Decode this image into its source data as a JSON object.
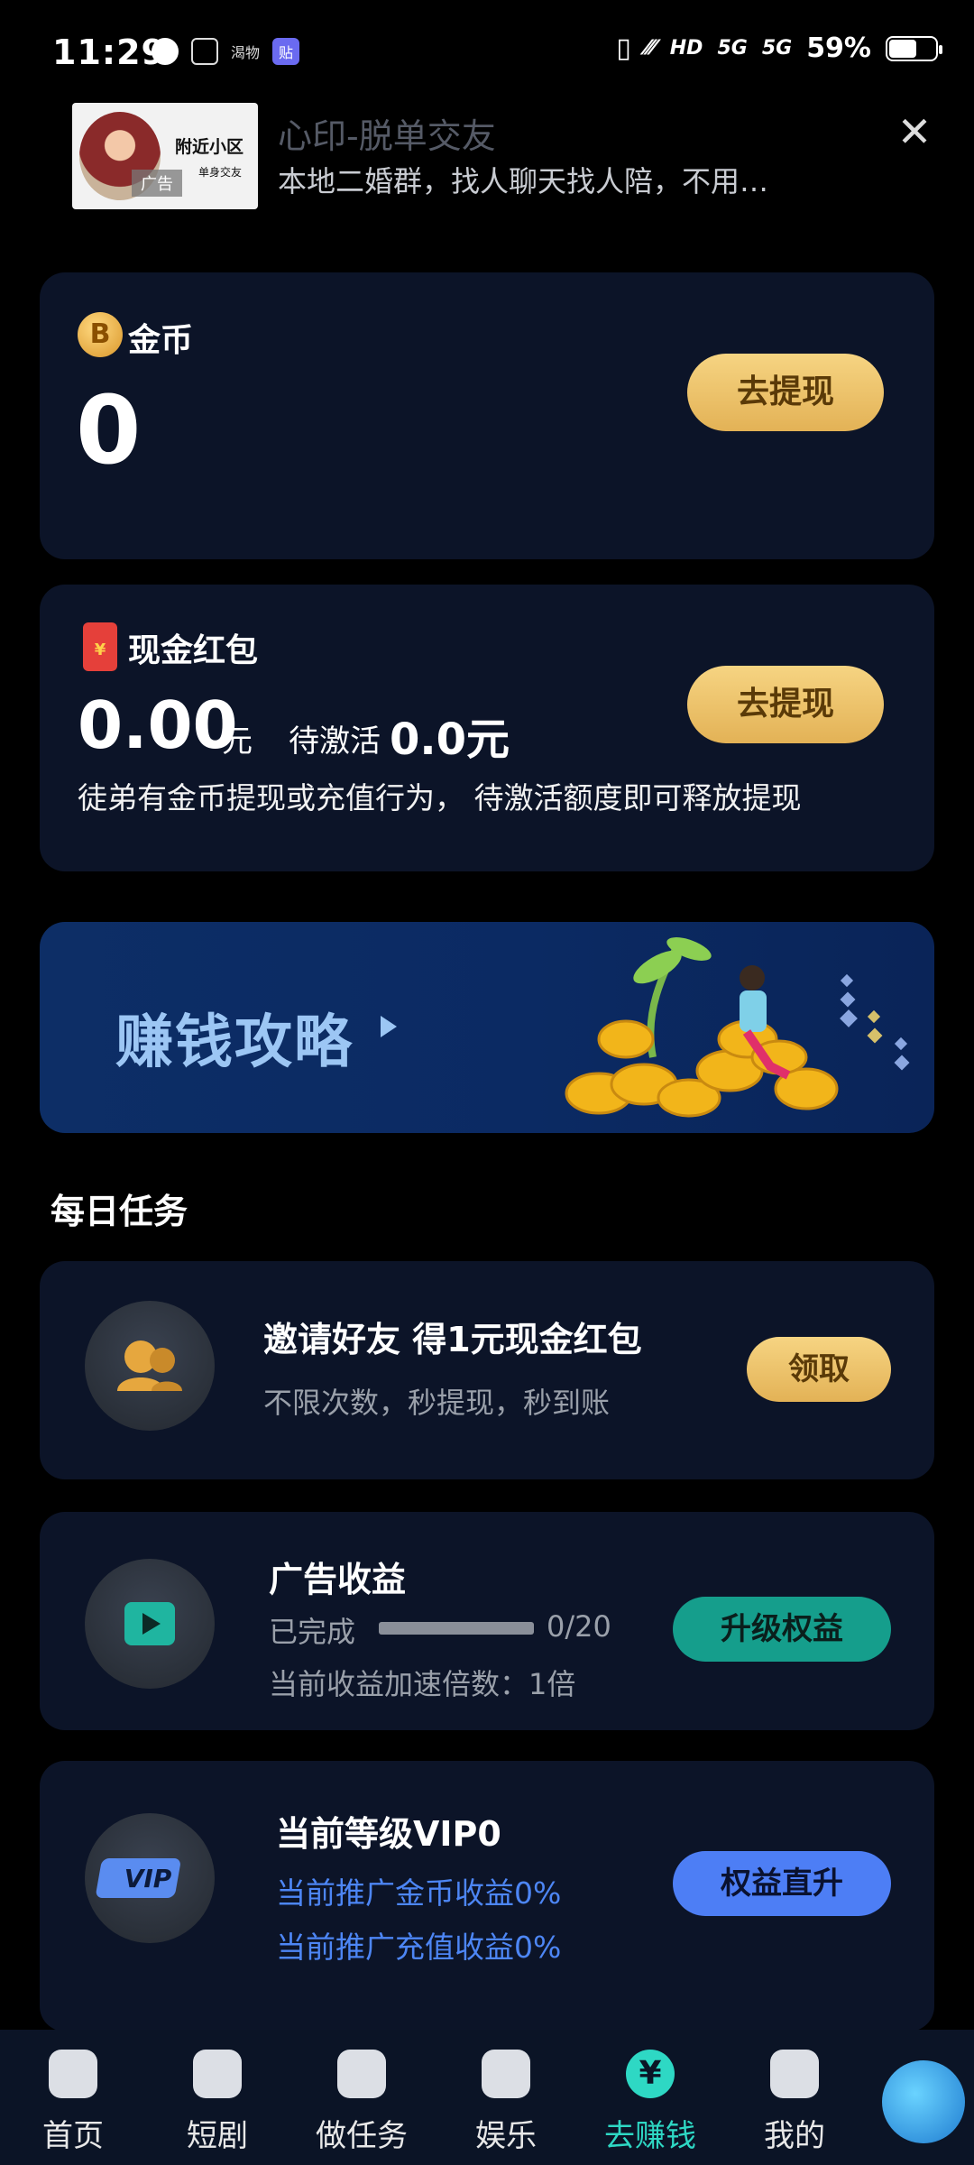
{
  "status_bar": {
    "time": "11:29",
    "icons": [
      "wechat-icon",
      "document-icon",
      "app-icon-text",
      "app-icon-badge"
    ],
    "left_text_icon": "渴物",
    "left_app_icon": "贴",
    "signal_label_1": "5G",
    "signal_label_2": "5G",
    "hd_label": "HD",
    "battery": "59%"
  },
  "ad": {
    "thumb_title": "附近小区",
    "thumb_sub": "单身交友",
    "tag": "广告",
    "title": "心印-脱单交友",
    "description": "本地二婚群，找人聊天找人陪，不用…",
    "close_symbol": "✕"
  },
  "coins_card": {
    "label": "金币",
    "coin_symbol": "B",
    "value": "0",
    "button": "去提现"
  },
  "cash_card": {
    "label": "现金红包",
    "amount": "0.00",
    "unit": "元",
    "pending_label": "待激活",
    "pending_value": "0.0元",
    "note": "徒弟有金币提现或充值行为， 待激活额度即可释放提现",
    "button": "去提现"
  },
  "banner": {
    "text": "赚钱攻略"
  },
  "daily_tasks": {
    "title": "每日任务",
    "invite": {
      "title": "邀请好友 得1元现金红包",
      "subtitle": "不限次数，秒提现，秒到账",
      "button": "领取"
    },
    "ad_income": {
      "title": "广告收益",
      "progress_label": "已完成",
      "progress_value": "0/20",
      "progress_fraction": 0,
      "multiplier": "当前收益加速倍数：1倍",
      "button": "升级权益"
    },
    "vip": {
      "title": "当前等级VIP0",
      "line1": "当前推广金币收益0%",
      "line2": "当前推广充值收益0%",
      "icon_text": "VIP",
      "button": "权益直升"
    }
  },
  "bottom_nav": {
    "items": [
      {
        "label": "首页",
        "icon": "home-icon"
      },
      {
        "label": "短剧",
        "icon": "clapperboard-icon"
      },
      {
        "label": "做任务",
        "icon": "task-chat-icon"
      },
      {
        "label": "娱乐",
        "icon": "entertainment-icon"
      },
      {
        "label": "去赚钱",
        "icon": "yuan-icon"
      },
      {
        "label": "我的",
        "icon": "profile-icon"
      }
    ],
    "active_index": 4,
    "yuan_symbol": "¥"
  },
  "colors": {
    "background": "#000000",
    "card": "#0c1428",
    "gold": "#e8bb5e",
    "teal": "#159e8c",
    "blue": "#4d7ef5",
    "active_nav": "#2ed8c4"
  }
}
